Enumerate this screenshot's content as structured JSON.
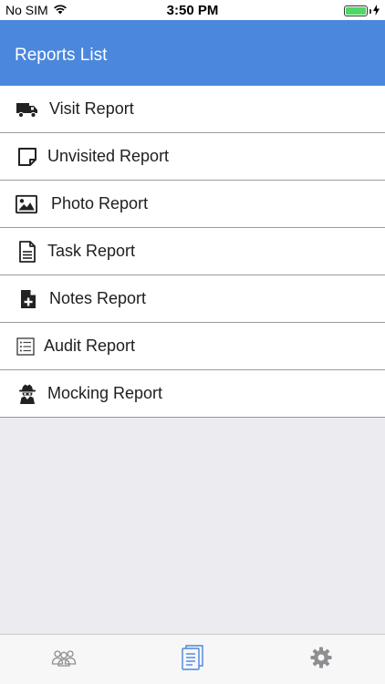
{
  "status_bar": {
    "carrier": "No SIM",
    "time": "3:50 PM"
  },
  "header": {
    "title": "Reports List"
  },
  "reports": [
    {
      "label": "Visit Report",
      "icon": "truck-icon"
    },
    {
      "label": "Unvisited Report",
      "icon": "note-icon"
    },
    {
      "label": "Photo Report",
      "icon": "image-icon"
    },
    {
      "label": "Task Report",
      "icon": "document-icon"
    },
    {
      "label": "Notes Report",
      "icon": "file-plus-icon"
    },
    {
      "label": "Audit Report",
      "icon": "checklist-icon"
    },
    {
      "label": "Mocking Report",
      "icon": "spy-icon"
    }
  ],
  "tabs": [
    {
      "icon": "users-icon",
      "active": false
    },
    {
      "icon": "reports-icon",
      "active": true
    },
    {
      "icon": "gear-icon",
      "active": false
    }
  ],
  "colors": {
    "header": "#4a87dd",
    "tab_active": "#4a87dd",
    "tab_inactive": "#8e8e93",
    "battery": "#4cd964"
  }
}
